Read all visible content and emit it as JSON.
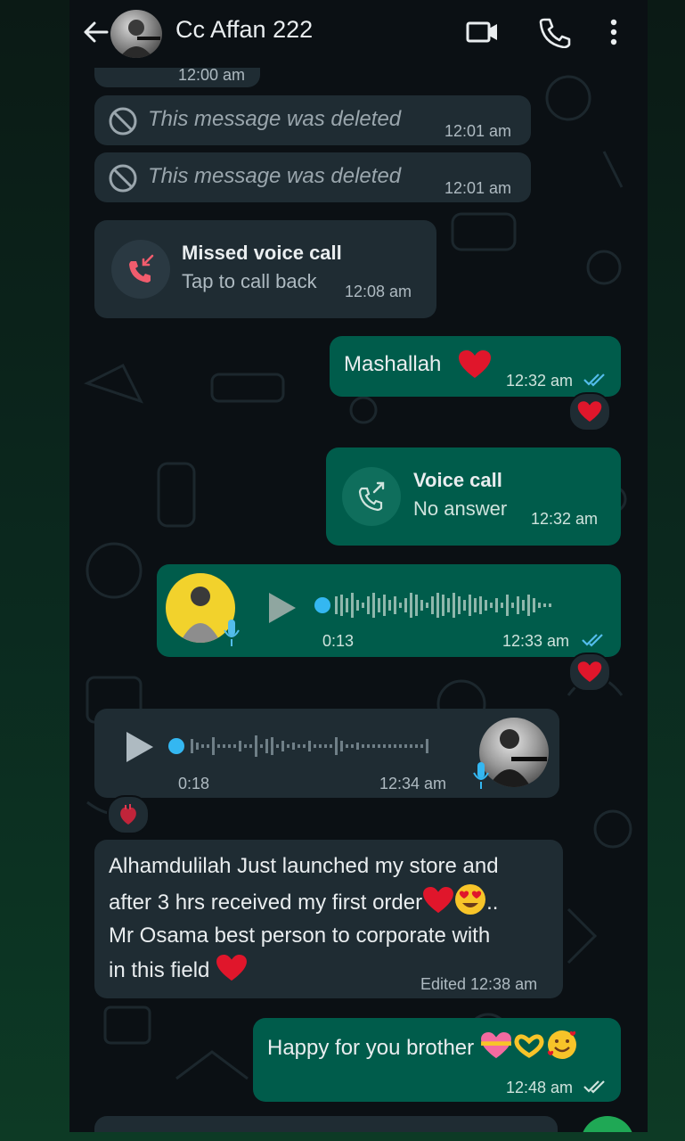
{
  "header": {
    "contact_name": "Cc Affan 222"
  },
  "messages": {
    "partial_top_time": "12:00 am",
    "deleted_1": {
      "text": "This message was deleted",
      "time": "12:01 am"
    },
    "deleted_2": {
      "text": "This message was deleted",
      "time": "12:01 am"
    },
    "missed_call": {
      "title": "Missed voice call",
      "subtitle": "Tap to call back",
      "time": "12:08 am"
    },
    "mashallah": {
      "text": "Mashallah",
      "time": "12:32 am"
    },
    "voice_call": {
      "title": "Voice call",
      "subtitle": "No answer",
      "time": "12:32 am"
    },
    "voice_note_out": {
      "duration": "0:13",
      "time": "12:33 am"
    },
    "voice_note_in": {
      "duration": "0:18",
      "time": "12:34 am"
    },
    "long_message": {
      "line1": "Alhamdulilah Just launched my store and",
      "line2": "after 3 hrs received my first order",
      "line2_tail": "..",
      "line3": "Mr Osama best person to corporate with",
      "line4": "in this field",
      "time": "Edited 12:38 am"
    },
    "happy": {
      "text": "Happy for you brother",
      "time": "12:48 am"
    }
  },
  "icons": {
    "back": "arrow-left-icon",
    "video": "video-camera-icon",
    "phone": "phone-icon",
    "menu": "more-vertical-icon",
    "deleted": "blocked-icon",
    "missed": "missed-call-icon",
    "outgoing": "outgoing-call-icon",
    "play": "play-icon",
    "mic": "mic-icon",
    "heart": "heart-icon"
  },
  "colors": {
    "header_bg": "#0b1014",
    "incoming_bubble": "#1f2c33",
    "outgoing_bubble": "#005c4b",
    "read_ticks": "#53bdeb",
    "missed_red": "#f15c6d",
    "voice_dot": "#34b7f1"
  }
}
